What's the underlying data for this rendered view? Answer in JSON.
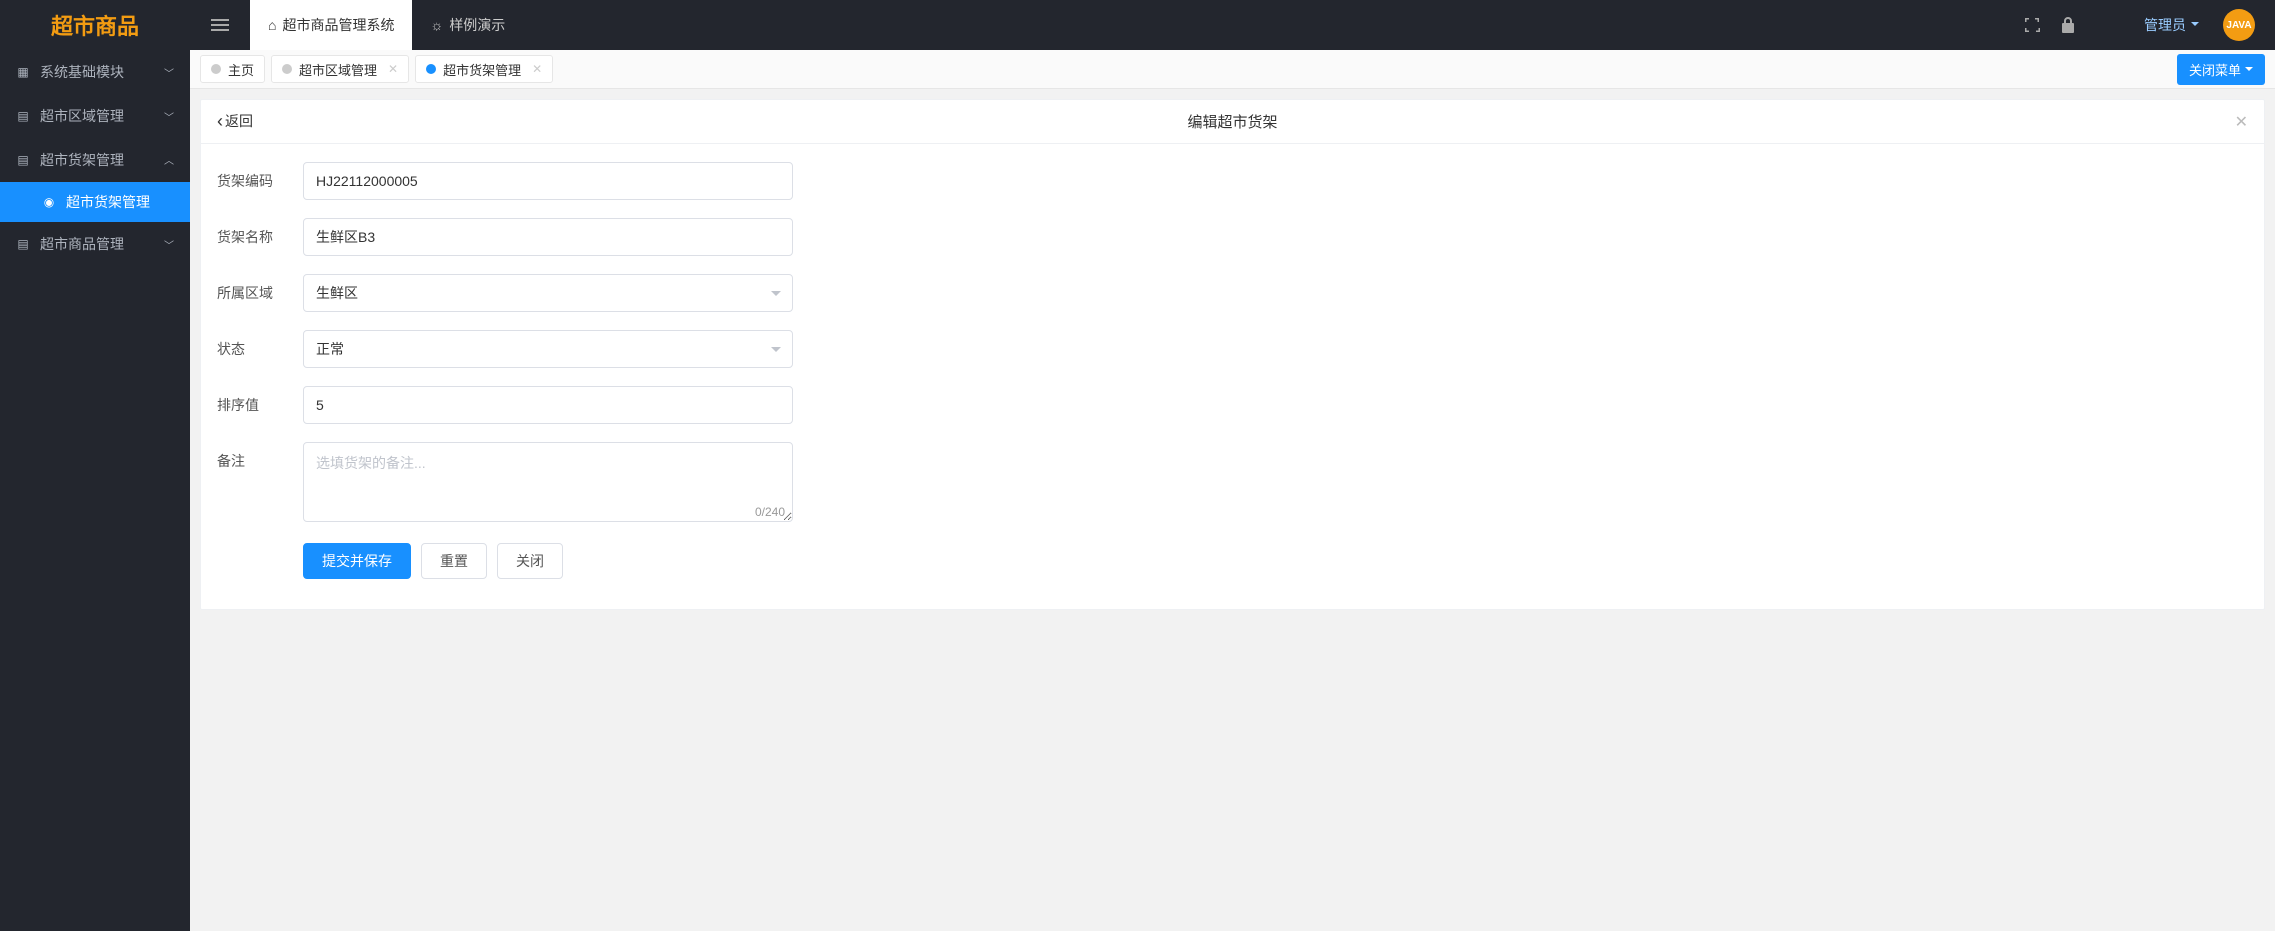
{
  "logo": "超市商品",
  "topTabs": [
    {
      "icon": "⌂",
      "label": "超市商品管理系统",
      "active": true
    },
    {
      "icon": "☼",
      "label": "样例演示",
      "active": false
    }
  ],
  "user": "管理员",
  "java": "JAVA",
  "sidebar": [
    {
      "icon": "▦",
      "label": "系统基础模块",
      "expanded": false
    },
    {
      "icon": "▤",
      "label": "超市区域管理",
      "expanded": false
    },
    {
      "icon": "▤",
      "label": "超市货架管理",
      "expanded": true,
      "children": [
        {
          "icon": "◉",
          "label": "超市货架管理",
          "active": true
        }
      ]
    },
    {
      "icon": "▤",
      "label": "超市商品管理",
      "expanded": false
    }
  ],
  "pageTabs": [
    {
      "label": "主页",
      "active": false,
      "closable": false
    },
    {
      "label": "超市区域管理",
      "active": false,
      "closable": true
    },
    {
      "label": "超市货架管理",
      "active": true,
      "closable": true
    }
  ],
  "closeMenu": "关闭菜单",
  "panel": {
    "back": "返回",
    "title": "编辑超市货架"
  },
  "form": {
    "code": {
      "label": "货架编码",
      "value": "HJ22112000005"
    },
    "name": {
      "label": "货架名称",
      "value": "生鲜区B3"
    },
    "area": {
      "label": "所属区域",
      "value": "生鲜区"
    },
    "status": {
      "label": "状态",
      "value": "正常"
    },
    "sort": {
      "label": "排序值",
      "value": "5"
    },
    "remark": {
      "label": "备注",
      "placeholder": "选填货架的备注...",
      "counter": "0/240"
    }
  },
  "buttons": {
    "submit": "提交并保存",
    "reset": "重置",
    "close": "关闭"
  }
}
